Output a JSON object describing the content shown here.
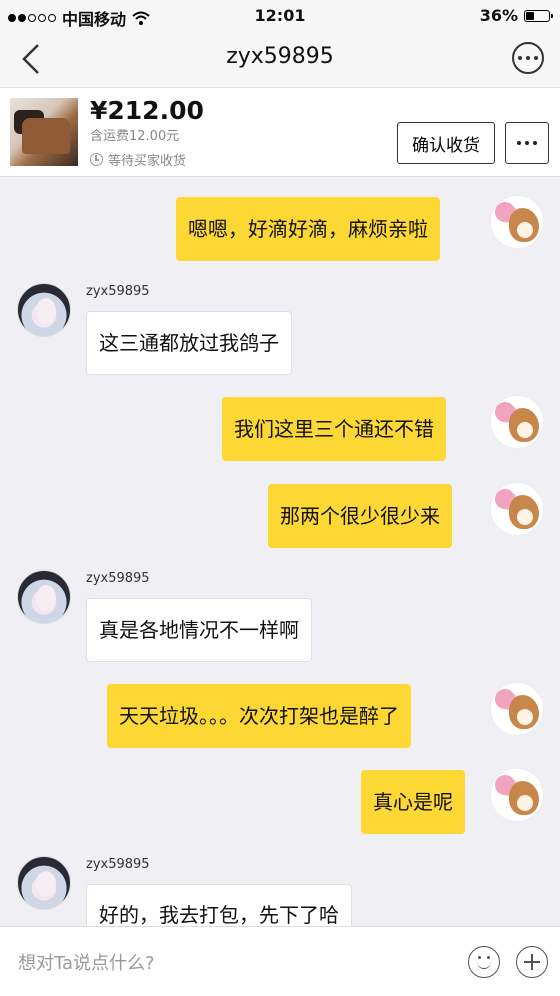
{
  "status_bar": {
    "carrier": "中国移动",
    "time": "12:01",
    "battery_percent": "36%",
    "battery_level": 0.36
  },
  "header": {
    "title": "zyx59895",
    "back_icon": "chevron-left-icon",
    "more_icon": "more-horizontal-icon"
  },
  "order": {
    "price": "¥212.00",
    "shipping": "含运费12.00元",
    "status": "等待买家收货",
    "confirm_label": "确认收货",
    "more_icon": "more-horizontal-icon"
  },
  "messages": [
    {
      "from": "me",
      "text": "嗯嗯，好滴好滴，麻烦亲啦"
    },
    {
      "from": "other",
      "sender": "zyx59895",
      "text": "这三通都放过我鸽子"
    },
    {
      "from": "me",
      "text": "我们这里三个通还不错"
    },
    {
      "from": "me",
      "text": "那两个很少很少来"
    },
    {
      "from": "other",
      "sender": "zyx59895",
      "text": "真是各地情况不一样啊"
    },
    {
      "from": "me",
      "text": "天天垃圾。。。次次打架也是醉了"
    },
    {
      "from": "me",
      "text": "真心是呢"
    },
    {
      "from": "other",
      "sender": "zyx59895",
      "text": "好的，我去打包，先下了哈"
    }
  ],
  "input": {
    "placeholder": "想对Ta说点什么?",
    "emoji_icon": "smiley-icon",
    "plus_icon": "plus-circle-icon"
  }
}
